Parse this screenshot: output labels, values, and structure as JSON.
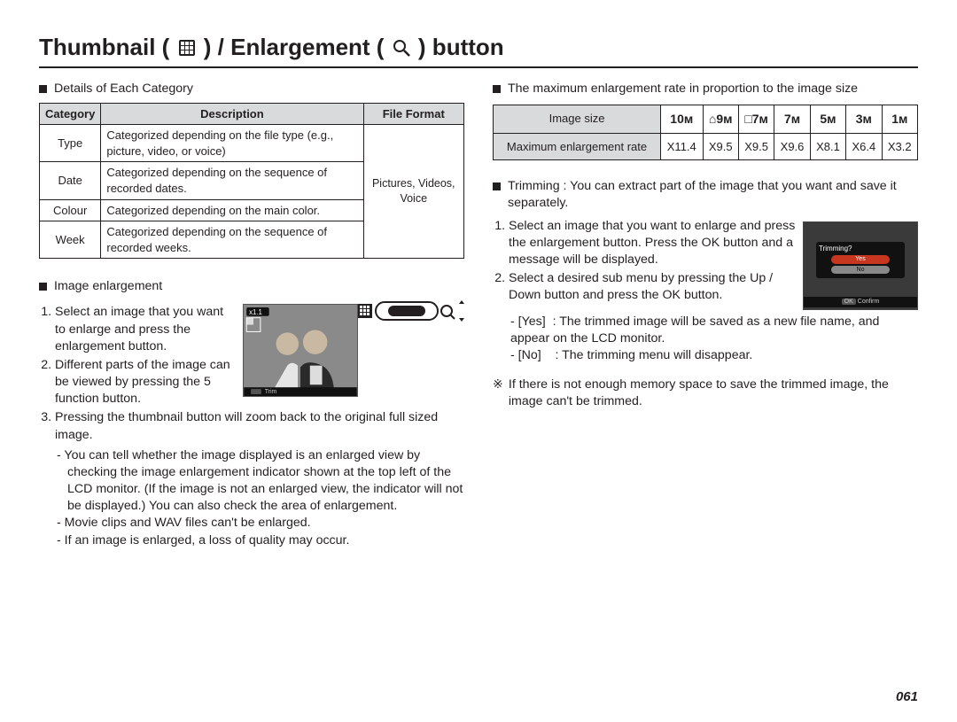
{
  "title_plain": "Thumbnail ( ▦ ) / Enlargement ( 🔍 ) button",
  "title_before": "Thumbnail ( ",
  "title_mid": " ) / Enlargement ( ",
  "title_after": " ) button",
  "left": {
    "heading1": "Details of Each Category",
    "table": {
      "headers": {
        "c": "Category",
        "d": "Description",
        "f": "File Format"
      },
      "rows": [
        {
          "c": "Type",
          "d": "Categorized depending on the file type (e.g., picture, video, or voice)"
        },
        {
          "c": "Date",
          "d": "Categorized depending on the sequence of recorded dates."
        },
        {
          "c": "Colour",
          "d": "Categorized depending on the main color."
        },
        {
          "c": "Week",
          "d": "Categorized depending on the sequence of recorded weeks."
        }
      ],
      "file_format": "Pictures, Videos, Voice"
    },
    "heading2": "Image enlargement",
    "steps": [
      "Select an image that you want to enlarge and press the enlargement button.",
      "Different parts of the image can be viewed by pressing the 5 function button.",
      "Pressing the thumbnail button will zoom back to the original full sized image."
    ],
    "notes": [
      "You can tell whether the image displayed is an enlarged view by checking the image enlargement indicator shown at the top left of the LCD monitor. (If the image is not an enlarged view, the indicator will not be displayed.) You can also check the area of enlargement.",
      "Movie clips and WAV files can't be enlarged.",
      "If an image is enlarged, a loss of quality may occur."
    ],
    "photo_badge": "x1.1",
    "photo_caption": "Trim"
  },
  "right": {
    "heading1": "The maximum enlargement rate in proportion to the image size",
    "rate_table": {
      "row1_label": "Image size",
      "row2_label": "Maximum enlargement rate",
      "sizes": [
        "10ᴍ",
        "⌂9ᴍ",
        "□7ᴍ",
        "7ᴍ",
        "5ᴍ",
        "3ᴍ",
        "1ᴍ"
      ],
      "rates": [
        "X11.4",
        "X9.5",
        "X9.5",
        "X9.6",
        "X8.1",
        "X6.4",
        "X3.2"
      ]
    },
    "trim_heading": "Trimming : You can extract part of the image that you want and save it separately.",
    "trim_steps": [
      "Select an image that you want to enlarge and press the enlargement button. Press the OK button and a message will be displayed.",
      "Select a desired sub menu by pressing the Up / Down button and press the OK button."
    ],
    "trim_options": {
      "yes_label": "- [Yes]",
      "yes_text": ": The trimmed image will be saved as a new file name, and appear on the LCD monitor.",
      "no_label": "- [No]",
      "no_text": ": The trimming menu will disappear."
    },
    "footnote_symbol": "※",
    "footnote": "If there is not enough memory space to save the trimmed image, the image can't be trimmed.",
    "dialog": {
      "title": "Trimming?",
      "yes": "Yes",
      "no": "No",
      "confirm": "Confirm"
    }
  },
  "page_number": "061"
}
